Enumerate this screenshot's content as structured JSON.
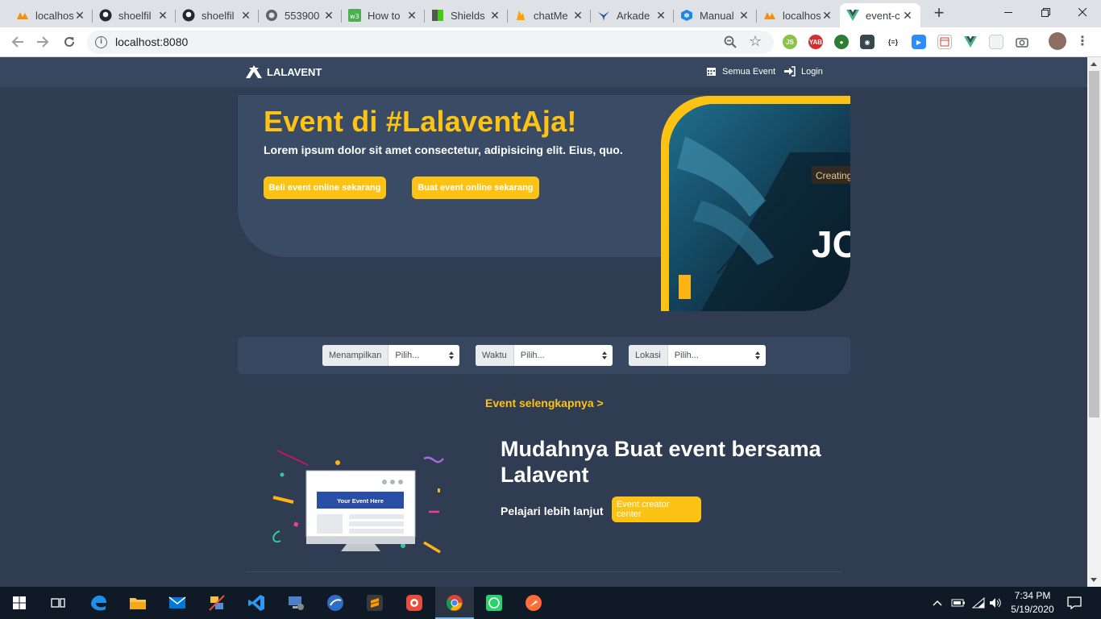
{
  "browser": {
    "tabs": [
      {
        "title": "localhost",
        "icon": "phpmyadmin-icon"
      },
      {
        "title": "shoelfil",
        "icon": "github-icon"
      },
      {
        "title": "shoelfil",
        "icon": "github-icon"
      },
      {
        "title": "553900",
        "icon": "globe-icon"
      },
      {
        "title": "How to",
        "icon": "w3schools-icon"
      },
      {
        "title": "Shields",
        "icon": "shields-icon"
      },
      {
        "title": "chatMe",
        "icon": "firebase-icon"
      },
      {
        "title": "Arkade",
        "icon": "arkademy-icon"
      },
      {
        "title": "Manual",
        "icon": "cube-icon"
      },
      {
        "title": "localhost",
        "icon": "phpmyadmin-icon"
      },
      {
        "title": "event-c",
        "icon": "vue-icon"
      }
    ],
    "url": "localhost:8080"
  },
  "site": {
    "brand": "LALAVENT",
    "nav": {
      "all_events": "Semua Event",
      "login": "Login"
    },
    "hero": {
      "title": "Event di #LalaventAja!",
      "subtitle": "Lorem ipsum dolor sit amet consectetur, adipisicing elit. Eius, quo.",
      "btn_buy": "Beli event online sekarang",
      "btn_create": "Buat event online sekarang",
      "image_text_small": "Creating a",
      "image_text_big": "JO"
    },
    "filters": [
      {
        "label": "Menampilkan",
        "value": "Pilih..."
      },
      {
        "label": "Waktu",
        "value": "Pilih..."
      },
      {
        "label": "Lokasi",
        "value": "Pilih..."
      }
    ],
    "more_events": "Event selengkapnya >",
    "promo": {
      "title": "Mudahnya Buat event bersama Lalavent",
      "learn_more": "Pelajari lebih lanjut",
      "creator_btn": "Event creator center",
      "monitor_text": "Your Event Here"
    }
  },
  "taskbar": {
    "time": "7:34 PM",
    "date": "5/19/2020"
  },
  "colors": {
    "accent": "#fcc314",
    "background": "#2f3c52",
    "card": "#3a4b65"
  }
}
